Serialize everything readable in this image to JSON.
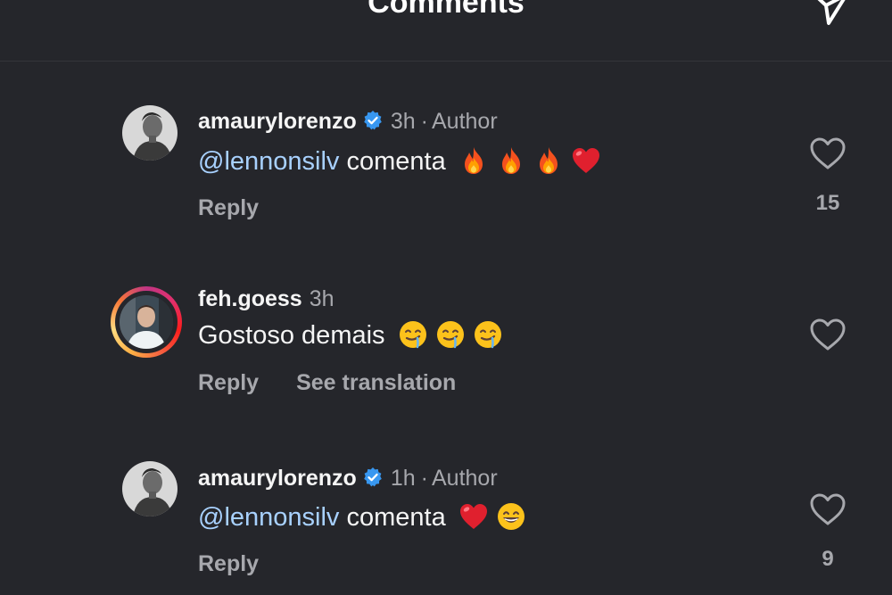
{
  "header": {
    "title": "Comments",
    "share_icon": "send-icon"
  },
  "comments": [
    {
      "username": "amaurylorenzo",
      "verified": true,
      "time": "3h",
      "dot": "·",
      "author_label": "Author",
      "mention": "@lennonsilv",
      "text": "comenta",
      "emojis": [
        "fire",
        "fire",
        "fire",
        "red-heart"
      ],
      "reply_label": "Reply",
      "like_count": "15"
    },
    {
      "username": "feh.goess",
      "verified": false,
      "time": "3h",
      "text": "Gostoso demais",
      "emojis": [
        "drooling-face",
        "drooling-face",
        "drooling-face"
      ],
      "reply_label": "Reply",
      "translate_label": "See translation",
      "has_story_ring": true
    },
    {
      "username": "amaurylorenzo",
      "verified": true,
      "time": "1h",
      "dot": "·",
      "author_label": "Author",
      "mention": "@lennonsilv",
      "text": "comenta",
      "emojis": [
        "red-heart",
        "grinning-face"
      ],
      "reply_label": "Reply",
      "like_count": "9"
    }
  ],
  "colors": {
    "background": "#25262b",
    "mention": "#a8d1ff",
    "muted": "#a7a8ad",
    "verified": "#3897f0"
  }
}
